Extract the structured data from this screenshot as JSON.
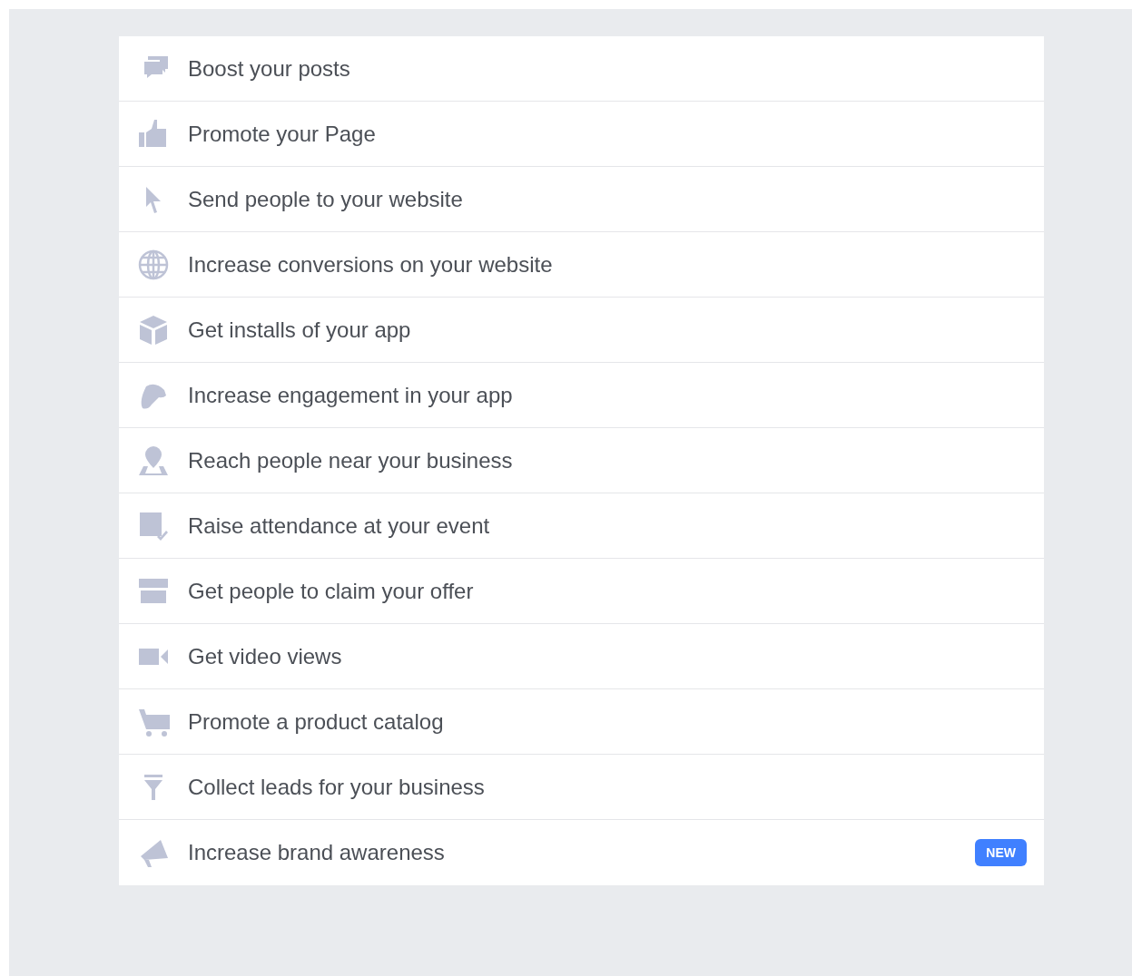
{
  "objectives": [
    {
      "label": "Boost your posts"
    },
    {
      "label": "Promote your Page"
    },
    {
      "label": "Send people to your website"
    },
    {
      "label": "Increase conversions on your website"
    },
    {
      "label": "Get installs of your app"
    },
    {
      "label": "Increase engagement in your app"
    },
    {
      "label": "Reach people near your business"
    },
    {
      "label": "Raise attendance at your event"
    },
    {
      "label": "Get people to claim your offer"
    },
    {
      "label": "Get video views"
    },
    {
      "label": "Promote a product catalog"
    },
    {
      "label": "Collect leads for your business"
    },
    {
      "label": "Increase brand awareness",
      "badge": "NEW"
    }
  ]
}
